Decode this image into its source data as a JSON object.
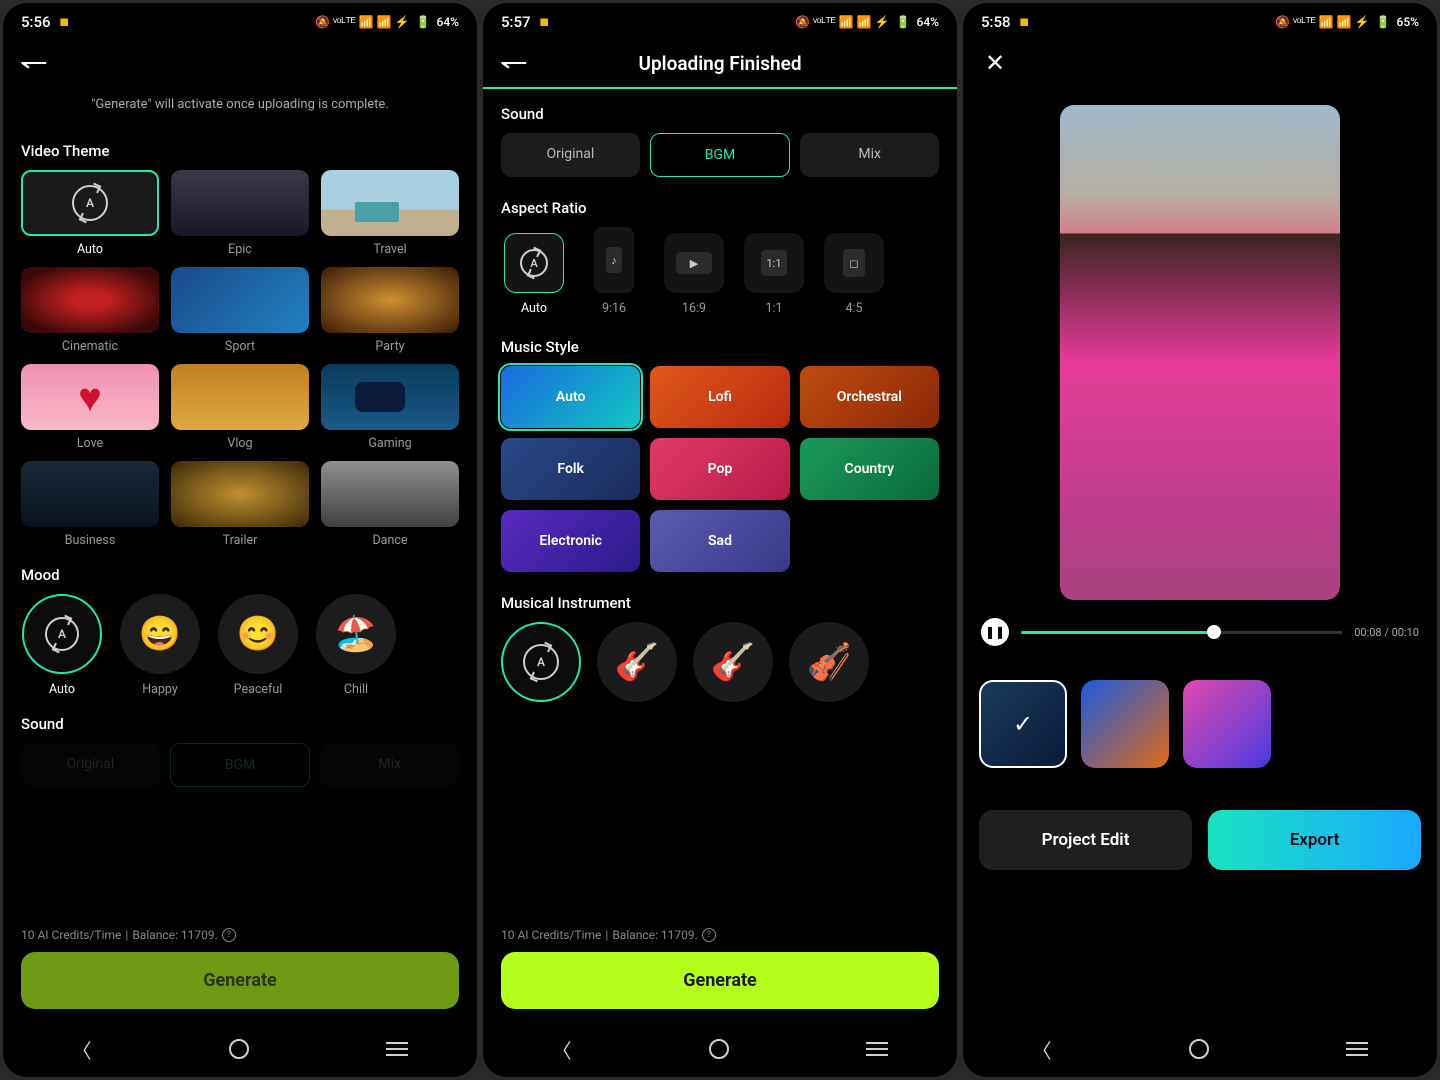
{
  "status": {
    "s1_time": "5:56",
    "s2_time": "5:57",
    "s3_time": "5:58",
    "s1_bat": "64%",
    "s2_bat": "64%",
    "s3_bat": "65%",
    "indicators": "🔕 ᵛᵒᴸᵀᴱ 📶 📶 ⚡"
  },
  "s1": {
    "hint": "\"Generate\" will activate once uploading is complete.",
    "theme_label": "Video Theme",
    "themes": [
      {
        "id": "auto",
        "label": "Auto",
        "sel": true
      },
      {
        "id": "epic",
        "label": "Epic"
      },
      {
        "id": "travel",
        "label": "Travel"
      },
      {
        "id": "cinematic",
        "label": "Cinematic"
      },
      {
        "id": "sport",
        "label": "Sport"
      },
      {
        "id": "party",
        "label": "Party"
      },
      {
        "id": "love",
        "label": "Love"
      },
      {
        "id": "vlog",
        "label": "Vlog"
      },
      {
        "id": "gaming",
        "label": "Gaming"
      },
      {
        "id": "business",
        "label": "Business"
      },
      {
        "id": "trailer",
        "label": "Trailer"
      },
      {
        "id": "dance",
        "label": "Dance"
      }
    ],
    "mood_label": "Mood",
    "moods": [
      {
        "id": "auto",
        "label": "Auto",
        "sel": true,
        "emoji": ""
      },
      {
        "id": "happy",
        "label": "Happy",
        "emoji": "😄"
      },
      {
        "id": "peaceful",
        "label": "Peaceful",
        "emoji": "😊"
      },
      {
        "id": "chill",
        "label": "Chill",
        "emoji": "🏖️"
      }
    ],
    "sound_label": "Sound",
    "sound_opts": {
      "original": "Original",
      "bgm": "BGM",
      "mix": "Mix"
    },
    "credits_a": "10 AI Credits/Time",
    "credits_b": "Balance: 11709.",
    "generate": "Generate"
  },
  "s2": {
    "title": "Uploading Finished",
    "sound_label": "Sound",
    "sound_opts": {
      "original": "Original",
      "bgm": "BGM",
      "mix": "Mix"
    },
    "ar_label": "Aspect Ratio",
    "ars": [
      {
        "id": "auto",
        "label": "Auto",
        "sel": true
      },
      {
        "id": "916",
        "label": "9:16"
      },
      {
        "id": "169",
        "label": "16:9"
      },
      {
        "id": "11",
        "label": "1:1"
      },
      {
        "id": "45",
        "label": "4:5"
      }
    ],
    "music_label": "Music Style",
    "music": [
      {
        "id": "auto",
        "label": "Auto",
        "bg": "linear-gradient(135deg,#1a6ae0,#10c8c0)",
        "sel": true
      },
      {
        "id": "lofi",
        "label": "Lofi",
        "bg": "linear-gradient(135deg,#e05a1a,#b82a10)"
      },
      {
        "id": "orchestral",
        "label": "Orchestral",
        "bg": "linear-gradient(135deg,#c04a10,#8a2808)"
      },
      {
        "id": "folk",
        "label": "Folk",
        "bg": "linear-gradient(135deg,#2a4a8a,#1a2a5a)"
      },
      {
        "id": "pop",
        "label": "Pop",
        "bg": "linear-gradient(135deg,#e03a6a,#b81a48)"
      },
      {
        "id": "country",
        "label": "Country",
        "bg": "linear-gradient(135deg,#1a9a5a,#0a6a3a)"
      },
      {
        "id": "electronic",
        "label": "Electronic",
        "bg": "linear-gradient(135deg,#5a2ac0,#2a1a8a)"
      },
      {
        "id": "sad",
        "label": "Sad",
        "bg": "linear-gradient(135deg,#5a5ab0,#3a3a8a)"
      }
    ],
    "inst_label": "Musical Instrument",
    "insts": [
      {
        "id": "auto",
        "sel": true,
        "emoji": ""
      },
      {
        "id": "acoustic",
        "emoji": "🎸"
      },
      {
        "id": "electric",
        "emoji": "🎸"
      },
      {
        "id": "violin",
        "emoji": "🎻"
      }
    ],
    "credits_a": "10 AI Credits/Time",
    "credits_b": "Balance: 11709.",
    "generate": "Generate"
  },
  "s3": {
    "time_cur": "00:08",
    "time_tot": "00:10",
    "project_edit": "Project Edit",
    "export": "Export",
    "results": [
      {
        "sel": true,
        "bg": "linear-gradient(135deg,#1a3a5a,#0a1a3a)"
      },
      {
        "bg": "linear-gradient(135deg,#1a5ae0,#e06a1a)"
      },
      {
        "bg": "linear-gradient(135deg,#e04ab0,#4a3ae0)"
      }
    ]
  }
}
